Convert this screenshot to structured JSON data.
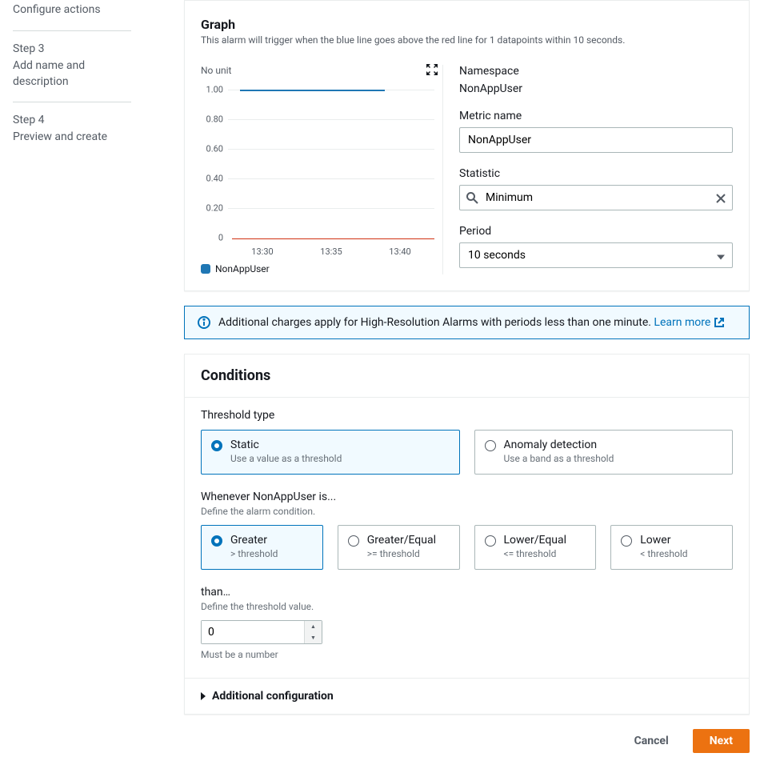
{
  "sidebar": {
    "link_configure_actions": "Configure actions",
    "step3_label": "Step 3",
    "step3_title": "Add name and description",
    "step4_label": "Step 4",
    "step4_title": "Preview and create"
  },
  "graph": {
    "heading": "Graph",
    "subtitle": "This alarm will trigger when the blue line goes above the red line for 1 datapoints within 10 seconds.",
    "no_unit": "No unit",
    "legend_item": "NonAppUser"
  },
  "chart_data": {
    "type": "line",
    "series": [
      {
        "name": "NonAppUser",
        "color": "#1f77b4",
        "values": [
          1.0,
          1.0,
          1.0
        ]
      },
      {
        "name": "threshold",
        "color": "#d13212",
        "values": [
          0,
          0,
          0
        ]
      }
    ],
    "x_ticks": [
      "13:30",
      "13:35",
      "13:40"
    ],
    "y_ticks": [
      "1.00",
      "0.80",
      "0.60",
      "0.40",
      "0.20",
      "0"
    ],
    "ylim": [
      0,
      1.0
    ],
    "ylabel": "No unit"
  },
  "right_panel": {
    "namespace_label": "Namespace",
    "namespace_value": "NonAppUser",
    "metric_name_label": "Metric name",
    "metric_name_value": "NonAppUser",
    "statistic_label": "Statistic",
    "statistic_value": "Minimum",
    "period_label": "Period",
    "period_value": "10 seconds"
  },
  "info_bar": {
    "text": "Additional charges apply for High-Resolution Alarms with periods less than one minute. ",
    "link": "Learn more"
  },
  "conditions": {
    "heading": "Conditions",
    "threshold_type_label": "Threshold type",
    "threshold_tiles": [
      {
        "title": "Static",
        "sub": "Use a value as a threshold",
        "selected": true
      },
      {
        "title": "Anomaly detection",
        "sub": "Use a band as a threshold",
        "selected": false
      }
    ],
    "whenever_label": "Whenever NonAppUser is...",
    "whenever_hint": "Define the alarm condition.",
    "comparison_tiles": [
      {
        "title": "Greater",
        "sub": "> threshold",
        "selected": true
      },
      {
        "title": "Greater/Equal",
        "sub": ">= threshold",
        "selected": false
      },
      {
        "title": "Lower/Equal",
        "sub": "<= threshold",
        "selected": false
      },
      {
        "title": "Lower",
        "sub": "< threshold",
        "selected": false
      }
    ],
    "than_label": "than…",
    "than_hint": "Define the threshold value.",
    "than_value": "0",
    "than_helper": "Must be a number",
    "additional_config": "Additional configuration"
  },
  "footer": {
    "cancel": "Cancel",
    "next": "Next"
  }
}
